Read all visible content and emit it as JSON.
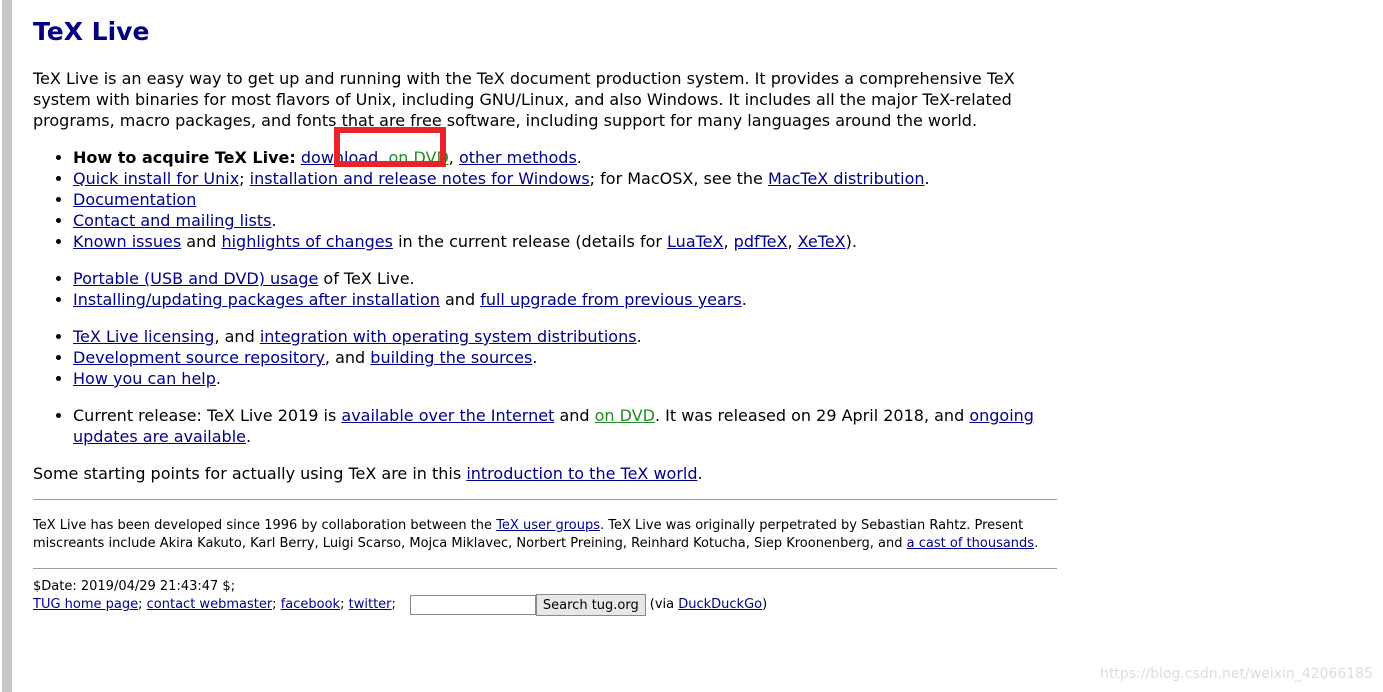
{
  "title": "TeX Live",
  "intro": "TeX Live is an easy way to get up and running with the TeX document production system. It provides a comprehensive TeX system with binaries for most flavors of Unix, including GNU/Linux, and also Windows. It includes all the major TeX-related programs, macro packages, and fonts that are free software, including support for many languages around the world.",
  "list1": {
    "acquire_label": "How to acquire TeX Live:",
    "download": "download",
    "comma": ",",
    "on_dvd": "on DVD",
    "other_methods": "other methods",
    "period": ".",
    "quick_install": "Quick install for Unix",
    "semicolon": ";",
    "install_notes_windows": "installation and release notes for Windows",
    "macosx_text": "; for MacOSX, see the",
    "mactex": "MacTeX distribution",
    "documentation": "Documentation",
    "contact": "Contact and mailing lists",
    "known_issues": "Known issues",
    "and": "and",
    "highlights": "highlights of changes",
    "current_release_text": "in the current release (details for",
    "luatex": "LuaTeX",
    "pdftex": "pdfTeX",
    "xetex": "XeTeX",
    "close": ")."
  },
  "list2": {
    "portable": "Portable (USB and DVD) usage",
    "of_texlive": "of TeX Live.",
    "installing_updating": "Installing/updating packages after installation",
    "and": "and",
    "full_upgrade": "full upgrade from previous years",
    "period": "."
  },
  "list3": {
    "licensing": "TeX Live licensing",
    "and": ", and",
    "integration": "integration with operating system distributions",
    "period": ".",
    "dev_source": "Development source repository",
    "building": "building the sources",
    "how_help": "How you can help"
  },
  "list4": {
    "current_release": "Current release: TeX Live 2019 is",
    "available_internet": "available over the Internet",
    "and": "and",
    "on_dvd": "on DVD",
    "released_text": ". It was released on 29 April 2018, and",
    "ongoing_updates": "ongoing updates are available",
    "period": "."
  },
  "starting": {
    "text": "Some starting points for actually using TeX are in this",
    "link": "introduction to the TeX world",
    "period": "."
  },
  "credits": {
    "text1": "TeX Live has been developed since 1996 by collaboration between the",
    "tex_user_groups": "TeX user groups",
    "text2": ". TeX Live was originally perpetrated by Sebastian Rahtz. Present miscreants include Akira Kakuto, Karl Berry, Luigi Scarso, Mojca Miklavec, Norbert Preining, Reinhard Kotucha, Siep Kroonenberg, and",
    "cast": "a cast of thousands",
    "period": "."
  },
  "footer": {
    "date": "$Date: 2019/04/29 21:43:47 $;",
    "tug_home": "TUG home page",
    "contact_webmaster": "contact webmaster",
    "facebook": "facebook",
    "twitter": "twitter",
    "sep": ";",
    "search_value": "",
    "search_button": "Search tug.org",
    "via_open": "(via",
    "duckduckgo": "DuckDuckGo",
    "via_close": ")"
  },
  "watermark": "https://blog.csdn.net/weixin_42066185",
  "colors": {
    "title": "#000080",
    "link": "#00008b",
    "visited_link": "#228b22",
    "highlight_box": "#e8232a"
  }
}
